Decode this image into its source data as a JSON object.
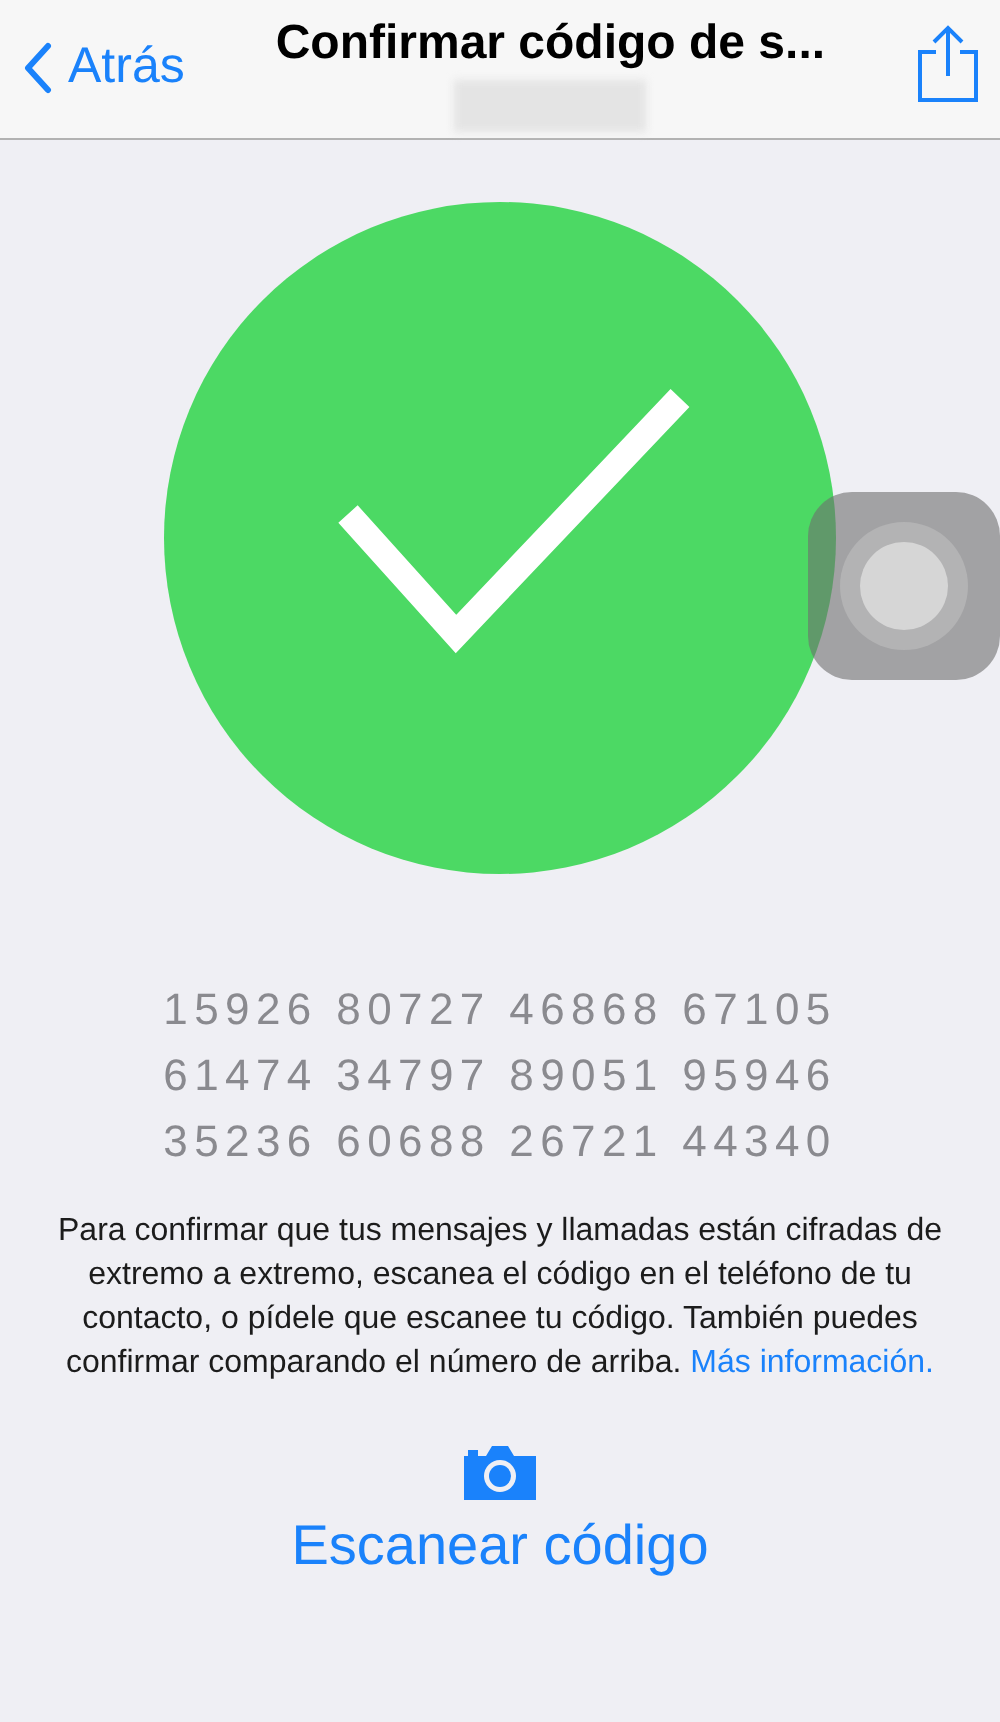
{
  "nav": {
    "back": "Atrás",
    "title": "Confirmar código de s..."
  },
  "verified": true,
  "code_rows": [
    "15926 80727 46868 67105",
    "61474 34797 89051 95946",
    "35236 60688 26721 44340"
  ],
  "description": {
    "text": "Para confirmar que tus mensajes y llamadas están cifradas de extremo a extremo, escanea el código en el teléfono de tu contacto, o pídele que escanee tu código. También puedes confirmar comparando el número de arriba.",
    "link": "Más información."
  },
  "scan_button": "Escanear código"
}
